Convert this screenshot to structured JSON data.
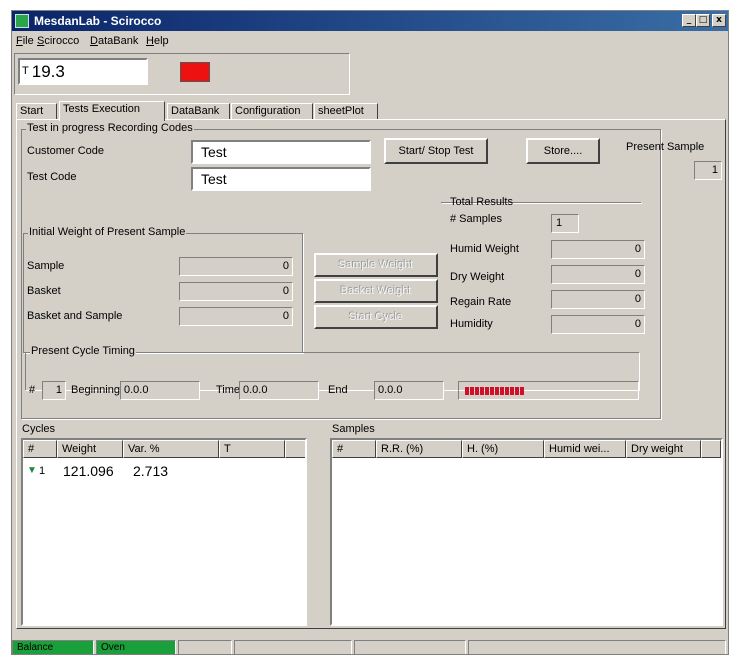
{
  "window": {
    "title": "MesdanLab - Scirocco",
    "minimize": "_",
    "maximize": "□",
    "close": "x"
  },
  "menu": [
    "File",
    "Scirocco",
    "DataBank",
    "Help"
  ],
  "top": {
    "t_label": "T",
    "t_value": "19.3",
    "indicator_color": "#ee1111"
  },
  "tabs": [
    "Start",
    "Tests Execution",
    "DataBank",
    "Configuration",
    "sheetPlot"
  ],
  "test": {
    "recording_label": "Test in progress Recording Codes",
    "customer_code_label": "Customer Code",
    "customer_code_value": "Test",
    "test_code_label": "Test Code",
    "test_code_value": "Test",
    "start_stop_button": "Start/ Stop Test",
    "store_button": "Store....",
    "present_sample_label": "Present Sample",
    "present_sample_value": "1"
  },
  "initial_weight": {
    "caption": "Initial Weight of Present Sample",
    "rows": [
      {
        "label": "Sample",
        "value": "0",
        "button": "Sample Weight"
      },
      {
        "label": "Basket",
        "value": "0",
        "button": "Basket Weight"
      },
      {
        "label": "Basket and Sample",
        "value": "0",
        "button": "Start Cycle"
      }
    ]
  },
  "total_results": {
    "caption": "Total Results",
    "samples_label": "# Samples",
    "samples_value": "1",
    "rows": [
      {
        "label": "Humid Weight",
        "value": "0"
      },
      {
        "label": "Dry Weight",
        "value": "0"
      },
      {
        "label": "Regain Rate",
        "value": "0"
      },
      {
        "label": "Humidity",
        "value": "0"
      }
    ]
  },
  "cycle_timing": {
    "caption": "Present Cycle Timing",
    "hash": "#",
    "index": "1",
    "beginning_label": "Beginning",
    "beginning_value": "0.0.0",
    "time_label": "Time",
    "time_value": "0.0.0",
    "end_label": "End",
    "end_value": "0.0.0",
    "progress_segments": 12,
    "progress_color": "#d0102a"
  },
  "cycles": {
    "label": "Cycles",
    "columns": [
      "#",
      "Weight",
      "Var. %",
      "T"
    ],
    "rows": [
      {
        "index": "1",
        "weight": "121.096",
        "var": "2.713",
        "t": ""
      }
    ]
  },
  "samples": {
    "label": "Samples",
    "columns": [
      "#",
      "R.R. (%)",
      "H. (%)",
      "Humid wei...",
      "Dry weight"
    ]
  },
  "status": {
    "panel1": "Balance",
    "panel2": "Oven",
    "ok_color": "#1aa03a"
  }
}
